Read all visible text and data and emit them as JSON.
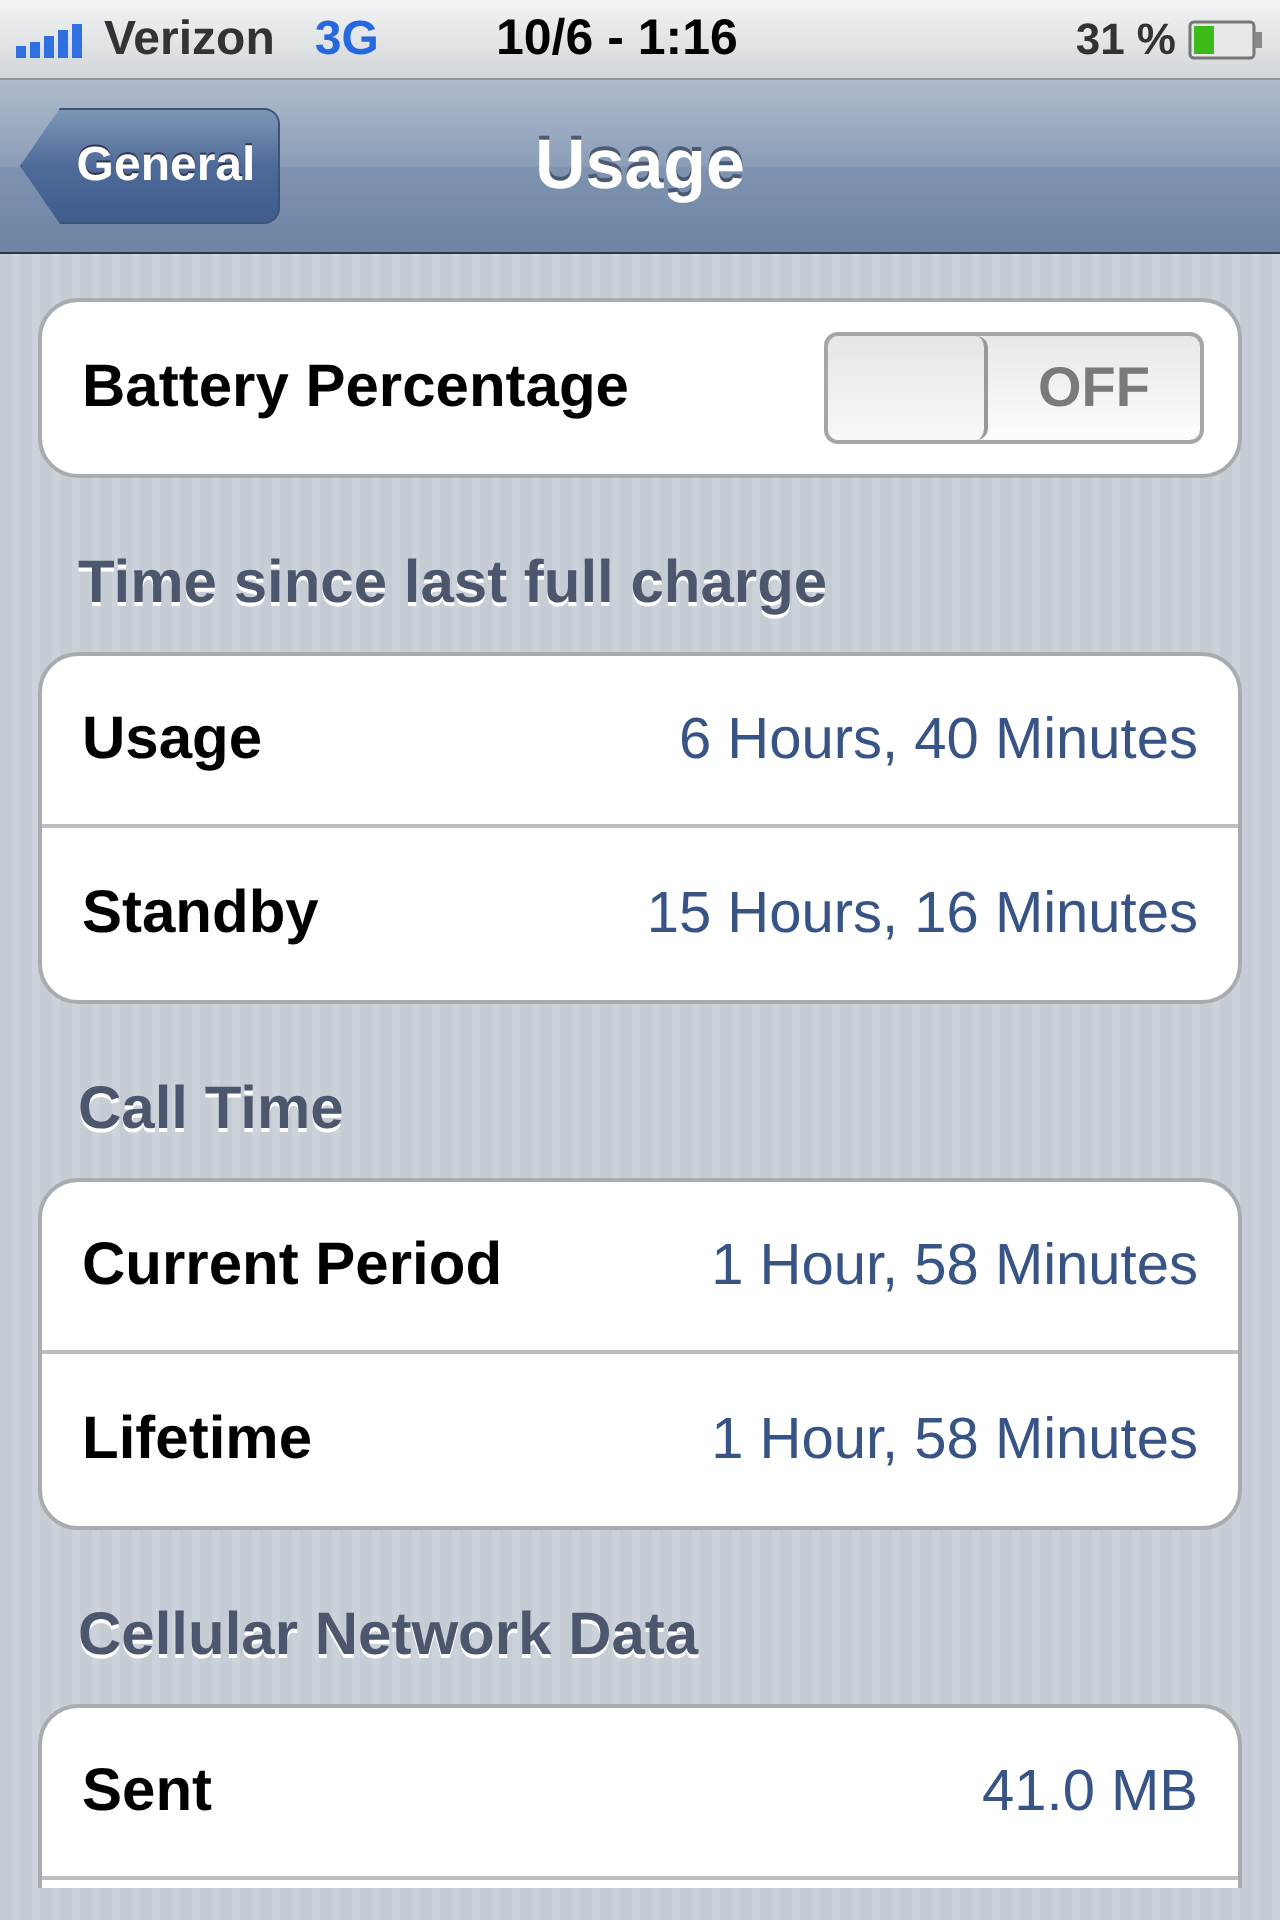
{
  "status_bar": {
    "carrier": "Verizon",
    "network": "3G",
    "time": "10/6 - 1:16",
    "battery": "31 %"
  },
  "nav_bar": {
    "back": "General",
    "title": "Usage"
  },
  "battery_row": {
    "label": "Battery Percentage",
    "toggle_text": "OFF",
    "on": false
  },
  "sections": [
    {
      "header": "Time since last full charge",
      "rows": [
        {
          "label": "Usage",
          "value": "6 Hours, 40 Minutes"
        },
        {
          "label": "Standby",
          "value": "15 Hours, 16 Minutes"
        }
      ]
    },
    {
      "header": "Call Time",
      "rows": [
        {
          "label": "Current Period",
          "value": "1 Hour, 58 Minutes"
        },
        {
          "label": "Lifetime",
          "value": "1 Hour, 58 Minutes"
        }
      ]
    },
    {
      "header": "Cellular Network Data",
      "rows": [
        {
          "label": "Sent",
          "value": "41.0 MB"
        }
      ]
    }
  ]
}
